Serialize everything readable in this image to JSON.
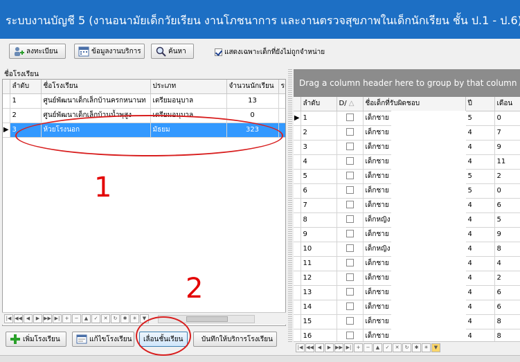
{
  "title": "ระบบงานบัญชี 5 (งานอนามัยเด็กวัยเรียน งานโภชนาการ และงานตรวจสุขภาพในเด็กนักเรียน ชั้น ป.1 - ป.6)",
  "toolbar": {
    "register_label": "ลงทะเบียน",
    "service_info_label": "ข้อมูลงานบริการ",
    "search_label": "ค้นหา",
    "show_unsold_label": "แสดงเฉพาะเด็กที่ยังไม่ถูกจำหน่าย",
    "show_unsold_checked": true
  },
  "left_panel": {
    "caption": "ชื่อโรงเรียน",
    "columns": [
      "ลำดับ",
      "ชื่อโรงเรียน",
      "ประเภท",
      "จำนวนนักเรียน",
      "ระ"
    ],
    "rows": [
      {
        "no": "1",
        "name": "ศูนย์พัฒนาเด็กเล็กบ้านครกหนานท",
        "type": "เตรียมอนุบาล",
        "count": "13"
      },
      {
        "no": "2",
        "name": "ศูนย์พัฒนาเด็กเล็กบ้านน้ำพุสูง",
        "type": "เตรียมอนุบาล",
        "count": "0"
      },
      {
        "no": "3",
        "name": "ห้วยโรงนอก",
        "type": "มัธยม",
        "count": "323"
      }
    ],
    "selected_row": 3,
    "buttons": {
      "add_school": "เพิ่มโรงเรียน",
      "edit_school": "แก้ไขโรงเรียน",
      "promote_class": "เลื่อนชั้นเรียน",
      "record_service": "บันทึกให้บริการโรงเรียน"
    }
  },
  "right_panel": {
    "group_hint": "Drag a column header here to group by that column",
    "columns": [
      "ลำดับ",
      "D/",
      "ชื่อเด็กที่รับผิดชอบ",
      "ปี",
      "เดือน"
    ],
    "rows": [
      {
        "no": "1",
        "name": "เด็กชาย",
        "year": "5",
        "month": "0"
      },
      {
        "no": "2",
        "name": "เด็กชาย",
        "year": "4",
        "month": "7"
      },
      {
        "no": "3",
        "name": "เด็กชาย",
        "year": "4",
        "month": "9"
      },
      {
        "no": "4",
        "name": "เด็กชาย",
        "year": "4",
        "month": "11"
      },
      {
        "no": "5",
        "name": "เด็กชาย",
        "year": "5",
        "month": "2"
      },
      {
        "no": "6",
        "name": "เด็กชาย",
        "year": "5",
        "month": "0"
      },
      {
        "no": "7",
        "name": "เด็กชาย",
        "year": "4",
        "month": "6"
      },
      {
        "no": "8",
        "name": "เด็กหญิง",
        "year": "4",
        "month": "5"
      },
      {
        "no": "9",
        "name": "เด็กชาย",
        "year": "4",
        "month": "9"
      },
      {
        "no": "10",
        "name": "เด็กหญิง",
        "year": "4",
        "month": "8"
      },
      {
        "no": "11",
        "name": "เด็กชาย",
        "year": "4",
        "month": "4"
      },
      {
        "no": "12",
        "name": "เด็กชาย",
        "year": "4",
        "month": "2"
      },
      {
        "no": "13",
        "name": "เด็กชาย",
        "year": "4",
        "month": "6"
      },
      {
        "no": "14",
        "name": "เด็กชาย",
        "year": "4",
        "month": "6"
      },
      {
        "no": "15",
        "name": "เด็กชาย",
        "year": "4",
        "month": "8"
      },
      {
        "no": "16",
        "name": "เด็กชาย",
        "year": "4",
        "month": "8"
      }
    ]
  },
  "annotations": {
    "mark_1": "1",
    "mark_2": "2"
  },
  "colors": {
    "titlebar": "#1d6fc4",
    "selection": "#3399ff",
    "annotation": "#e30000"
  }
}
